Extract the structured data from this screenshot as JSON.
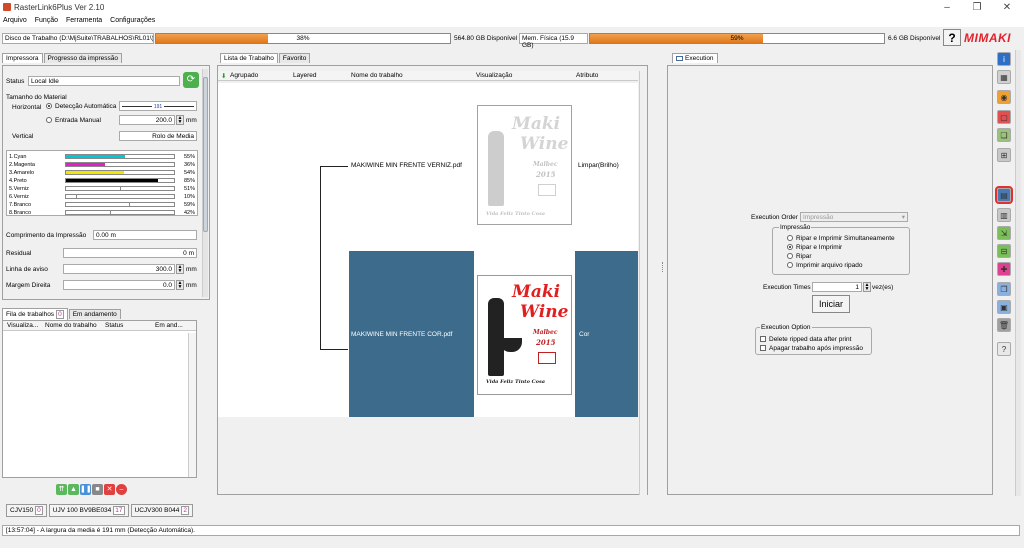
{
  "window": {
    "title": "RasterLink6Plus Ver 2.10"
  },
  "menu": [
    "Arquivo",
    "Função",
    "Ferramenta",
    "Configurações"
  ],
  "status_row": {
    "disk_label": "Disco de Trabalho (D:\\MjSuite\\TRABALHOS\\RL01\\)",
    "disk_percent": 38,
    "disk_percent_text": "38%",
    "disk_free": "564.80 GB Disponível",
    "mem_label": "Mem. Física (15.9 GB)",
    "mem_percent": 59,
    "mem_percent_text": "59%",
    "mem_free": "6.6 GB Disponível",
    "help": "?",
    "brand": "MIMAKI"
  },
  "left_panel": {
    "tabs": [
      "Impressora",
      "Progresso da impressão"
    ],
    "status_label": "Status",
    "status_value": "Local Idle",
    "material_size": "Tamanho do Material",
    "horizontal_label": "Horizontal",
    "auto_detect": "Detecção Automática",
    "auto_value": "191",
    "manual_entry": "Entrada Manual",
    "manual_value": "200.0",
    "unit_mm": "mm",
    "vertical_label": "Vertical",
    "vertical_value": "Rolo de Media",
    "inks": [
      {
        "name": "1.Cyan",
        "color": "#00c8d8",
        "level": 0.55,
        "pct": "55%"
      },
      {
        "name": "2.Magenta",
        "color": "#e020c8",
        "level": 0.36,
        "pct": "36%"
      },
      {
        "name": "3.Amarelo",
        "color": "#f0e800",
        "level": 0.54,
        "pct": "54%"
      },
      {
        "name": "4.Preto",
        "color": "#000000",
        "level": 0.85,
        "pct": "85%"
      },
      {
        "name": "5.Verniz",
        "color": "#ffffff",
        "level": 0.51,
        "pct": "51%"
      },
      {
        "name": "6.Verniz",
        "color": "#ffffff",
        "level": 0.1,
        "pct": "10%"
      },
      {
        "name": "7.Branco",
        "color": "#ffffff",
        "level": 0.59,
        "pct": "59%"
      },
      {
        "name": "8.Branco",
        "color": "#ffffff",
        "level": 0.42,
        "pct": "42%"
      }
    ],
    "print_length_label": "Comprimento da Impressão",
    "print_length_value": "0.00 m",
    "residual_label": "Residual",
    "residual_value": "0 m",
    "warning_line_label": "Linha de aviso",
    "warning_line_value": "300.0",
    "right_margin_label": "Margem Direita",
    "right_margin_value": "0.0"
  },
  "queue_panel": {
    "tab_queue": "Fila de trabalhos",
    "queue_count": "0",
    "tab_progress": "Em andamento",
    "columns": [
      "Visualiza...",
      "Nome do trabalho",
      "Status",
      "Em and..."
    ]
  },
  "printers": [
    {
      "name": "CJV150",
      "count": "0"
    },
    {
      "name": "UJV 100 BV9BE034",
      "count": "17"
    },
    {
      "name": "UCJV300 B044",
      "count": "2"
    }
  ],
  "log_message": "[13:57:04] - A largura da media é 191 mm (Detecção Automática).",
  "job_list": {
    "tabs": [
      "Lista de Trabalho",
      "Favorito"
    ],
    "columns": [
      "Agrupado",
      "Layered",
      "Nome do trabalho",
      "Visualização",
      "Atributo"
    ],
    "jobs": [
      {
        "name": "MAKIWINE MIN FRENTE VERNIZ.pdf",
        "attribute": "Limpar(Brilho)",
        "selected": false
      },
      {
        "name": "MAKIWINE MIN FRENTE COR.pdf",
        "attribute": "Cor",
        "selected": true
      }
    ],
    "thumb_text": {
      "brand1": "Maki",
      "brand2": "Wine",
      "vintage": "Malbec",
      "year": "2015",
      "signature": "Vida Feliz Tinto Cosa"
    }
  },
  "execution": {
    "tab": "Execution",
    "order_label": "Execution Order",
    "order_value": "Impressão",
    "group_title": "Impressão",
    "options": [
      {
        "label": "Ripar e Imprimir Simultaneamente",
        "selected": false
      },
      {
        "label": "Ripar e Imprimir",
        "selected": true
      },
      {
        "label": "Ripar",
        "selected": false
      },
      {
        "label": "Imprimir arquivo ripado",
        "selected": false
      }
    ],
    "times_label": "Execution Times",
    "times_value": "1",
    "times_unit": "vez(es)",
    "start_button": "Iniciar",
    "option_title": "Execution Option",
    "checkboxes": [
      "Delete ripped data after print",
      "Apagar trabalho após impressão"
    ]
  },
  "toolbar_icons": [
    "info-icon",
    "layout-icon",
    "color-icon",
    "crop-icon",
    "copy-icon",
    "arrange-icon",
    "print-icon",
    "tile-icon",
    "scale-icon",
    "merge-icon",
    "color-picker-icon",
    "duplicate-icon",
    "save-icon",
    "trash-icon",
    "help-page-icon"
  ]
}
